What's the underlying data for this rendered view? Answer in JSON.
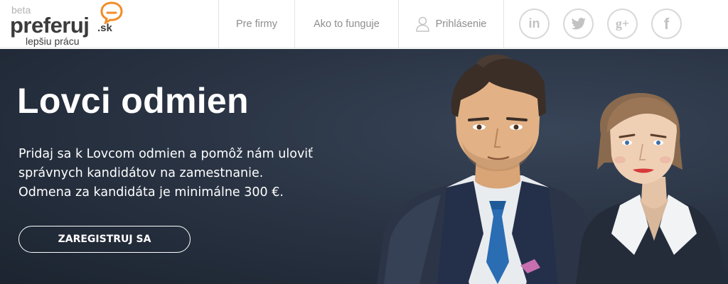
{
  "header": {
    "logo": {
      "beta": "beta",
      "name": "preferuj",
      "tld": ".sk",
      "tagline": "lepšiu prácu",
      "accent_color": "#f28c28"
    },
    "nav": [
      {
        "label": "Pre firmy"
      },
      {
        "label": "Ako to funguje"
      },
      {
        "label": "Prihlásenie",
        "icon": "user-icon"
      }
    ],
    "social": [
      {
        "icon": "linkedin-icon",
        "glyph": "in"
      },
      {
        "icon": "twitter-icon"
      },
      {
        "icon": "google-plus-icon",
        "glyph": "g+"
      },
      {
        "icon": "facebook-icon",
        "glyph": "f"
      }
    ]
  },
  "hero": {
    "title": "Lovci odmien",
    "lines": [
      "Pridaj sa k Lovcom odmien a pomôž nám uloviť",
      "správnych kandidátov na zamestnanie.",
      "Odmena za kandidáta je minimálne 300 €."
    ],
    "cta_label": "ZAREGISTRUJ SA",
    "background_color": "#2a3444"
  }
}
